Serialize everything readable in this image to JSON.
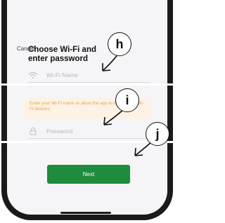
{
  "cancel_label": "Cancel",
  "title": "Choose Wi-Fi and enter password",
  "wifi_field": {
    "placeholder": "Wi-Fi Name",
    "icon": "wifi-icon"
  },
  "hint_text": "Enter your Wi-Fi name or allow the app to find nearby Wi-Fi devices",
  "password_field": {
    "placeholder": "Password",
    "icon": "lock-icon"
  },
  "next_label": "Next",
  "callouts": {
    "h": "h",
    "i": "i",
    "j": "j"
  },
  "colors": {
    "accent": "#1f8b3c",
    "hint_bg": "#fdf2e4",
    "hint_text": "#f0a149",
    "phone_frame": "#1a1a1a"
  }
}
